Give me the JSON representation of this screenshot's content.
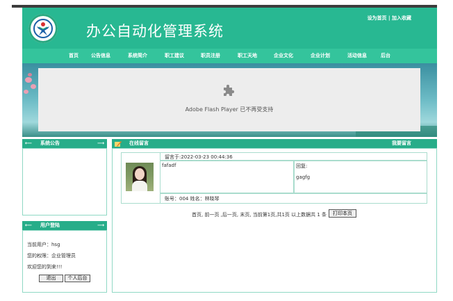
{
  "header": {
    "title": "办公自动化管理系统",
    "toplinks": "设为首页 | 加入收藏"
  },
  "nav": {
    "items": [
      "首页",
      "公告信息",
      "系统简介",
      "职工建议",
      "职员注册",
      "职工天地",
      "企业文化",
      "企业计划",
      "活动信息",
      "后台"
    ]
  },
  "banner": {
    "flash_text": "Adobe Flash Player 已不再受支持",
    "flash_icon": "puzzle-piece-icon"
  },
  "sidebar": {
    "notice_title": "系统公告",
    "login_title": "用户登陆",
    "current_user": "当前用户：hsg",
    "permission": "您的权限：企业管理员",
    "welcome": "欢迎您的到来!!!",
    "logout_label": "退出",
    "personal_label": "个人后台"
  },
  "messages": {
    "title": "在线留言",
    "post_link": "我要留言",
    "entry": {
      "time": "留言于:2022-03-23 00:44:36",
      "content": "fafadf",
      "reply_label": "回复:",
      "reply_content": "gagfg",
      "author": "账号：004   姓名：林晓琴"
    },
    "pagination": "首页, 前一页 ,后一页, 末页, 当前第1页,共1页 以上数据共 1 条",
    "print_label": "打印本页"
  },
  "colors": {
    "brand": "#28b892",
    "nav": "#34c49c",
    "panel_head": "#27ad89"
  }
}
